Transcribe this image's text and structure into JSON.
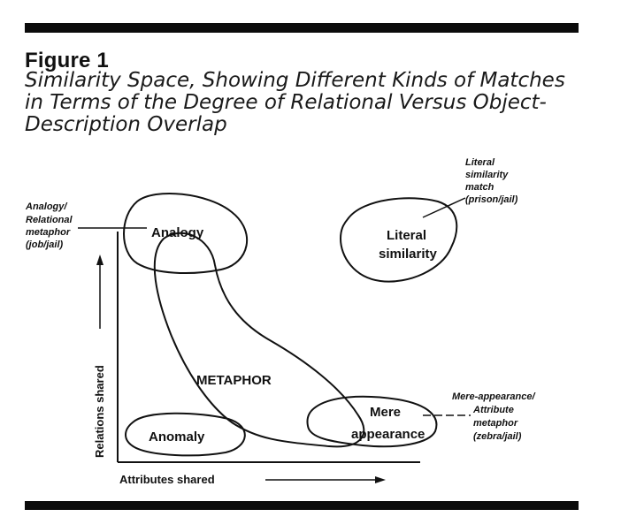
{
  "figure": {
    "label": "Figure 1",
    "caption_lines": [
      "Similarity Space, Showing Different Kinds of Matches",
      "in Terms of the Degree of Relational Versus Object-",
      "Description Overlap"
    ]
  },
  "axes": {
    "y_label": "Relations shared",
    "x_label": "Attributes shared"
  },
  "regions": {
    "analogy": "Analogy",
    "literal": [
      "Literal",
      "similarity"
    ],
    "metaphor": "METAPHOR",
    "mere": [
      "Mere",
      "appearance"
    ],
    "anomaly": "Anomaly"
  },
  "callouts": {
    "analogy": [
      "Analogy/",
      "Relational",
      "metaphor",
      "(job/jail)"
    ],
    "literal": [
      "Literal",
      "similarity",
      "match",
      "(prison/jail)"
    ],
    "mere": [
      "Mere-appearance/",
      "Attribute",
      "metaphor",
      "(zebra/jail)"
    ]
  }
}
